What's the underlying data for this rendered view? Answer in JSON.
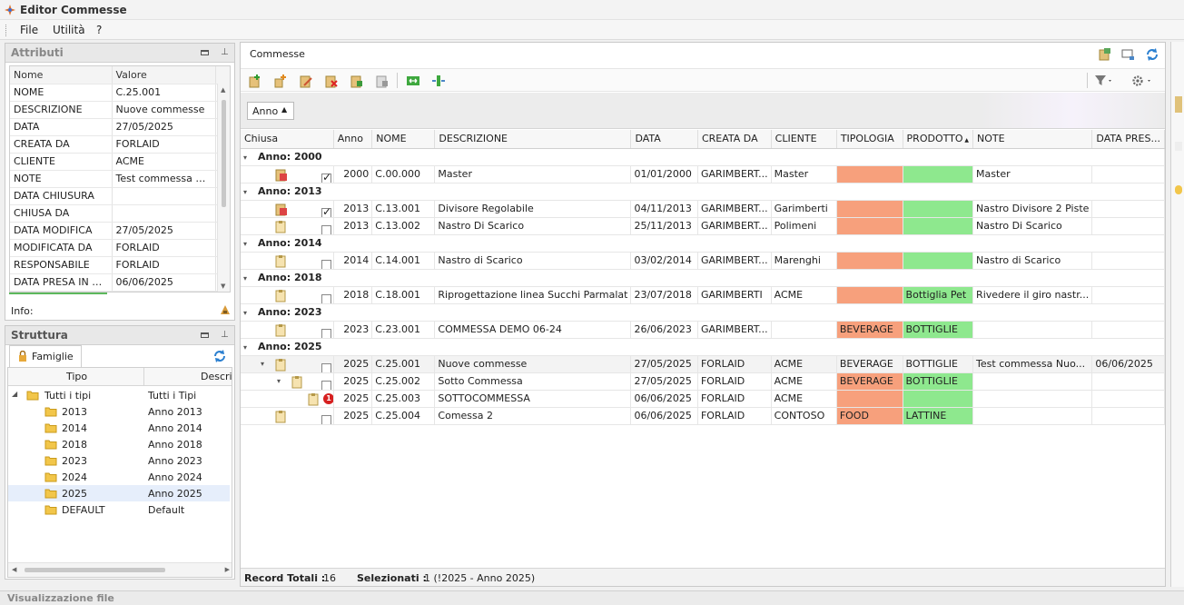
{
  "window": {
    "title": "Editor Commesse"
  },
  "menu": [
    "File",
    "Utilità",
    "?"
  ],
  "attributi": {
    "title": "Attributi",
    "headers": [
      "Nome",
      "Valore"
    ],
    "rows": [
      {
        "name": "NOME",
        "value": "C.25.001"
      },
      {
        "name": "DESCRIZIONE",
        "value": "Nuove commesse"
      },
      {
        "name": "DATA",
        "value": "27/05/2025"
      },
      {
        "name": "CREATA DA",
        "value": "FORLAID"
      },
      {
        "name": "CLIENTE",
        "value": "ACME"
      },
      {
        "name": "NOTE",
        "value": "Test commessa Nuov"
      },
      {
        "name": "DATA CHIUSURA",
        "value": ""
      },
      {
        "name": "CHIUSA DA",
        "value": ""
      },
      {
        "name": "DATA MODIFICA",
        "value": "27/05/2025"
      },
      {
        "name": "MODIFICATA DA",
        "value": "FORLAID"
      },
      {
        "name": "RESPONSABILE",
        "value": "FORLAID"
      },
      {
        "name": "DATA PRESA IN CA...",
        "value": "06/06/2025"
      }
    ],
    "info_label": "Info:"
  },
  "struttura": {
    "title": "Struttura",
    "tab": "Famiglie",
    "headers": [
      "Tipo",
      "Descriz"
    ],
    "items": [
      {
        "tipo": "Tutti i tipi",
        "descr": "Tutti i Tipi",
        "root": true
      },
      {
        "tipo": "2013",
        "descr": "Anno 2013"
      },
      {
        "tipo": "2014",
        "descr": "Anno 2014"
      },
      {
        "tipo": "2018",
        "descr": "Anno 2018"
      },
      {
        "tipo": "2023",
        "descr": "Anno 2023"
      },
      {
        "tipo": "2024",
        "descr": "Anno 2024"
      },
      {
        "tipo": "2025",
        "descr": "Anno 2025",
        "selected": true
      },
      {
        "tipo": "DEFAULT",
        "descr": "Default"
      }
    ]
  },
  "commesse": {
    "title": "Commesse",
    "group_chip": "Anno",
    "columns": [
      "Chiusa",
      "Anno",
      "NOME",
      "DESCRIZIONE",
      "DATA",
      "CREATA DA",
      "CLIENTE",
      "TIPOLOGIA",
      "PRODOTTO",
      "NOTE",
      "DATA PRES..."
    ],
    "groups": [
      {
        "label": "Anno: 2000",
        "rows": [
          {
            "level": 0,
            "expand": false,
            "red": true,
            "checked": true,
            "badge": "",
            "anno": "2000",
            "nome": "C.00.000",
            "descr": "Master",
            "data": "01/01/2000",
            "creata": "GARIMBERT...",
            "cliente": "Master",
            "tipologia": "",
            "tip_color": "#f7a07c",
            "prodotto": "",
            "prod_color": "#8ee88e",
            "note": "Master",
            "dpres": ""
          }
        ]
      },
      {
        "label": "Anno: 2013",
        "rows": [
          {
            "level": 0,
            "expand": false,
            "red": true,
            "checked": true,
            "badge": "",
            "anno": "2013",
            "nome": "C.13.001",
            "descr": "Divisore Regolabile",
            "data": "04/11/2013",
            "creata": "GARIMBERT...",
            "cliente": "Garimberti",
            "tipologia": "",
            "tip_color": "#f7a07c",
            "prodotto": "",
            "prod_color": "#8ee88e",
            "note": "Nastro Divisore 2 Piste",
            "dpres": ""
          },
          {
            "level": 0,
            "expand": false,
            "red": false,
            "checked": false,
            "badge": "",
            "anno": "2013",
            "nome": "C.13.002",
            "descr": "Nastro Di Scarico",
            "data": "25/11/2013",
            "creata": "GARIMBERT...",
            "cliente": "Polimeni",
            "tipologia": "",
            "tip_color": "#f7a07c",
            "prodotto": "",
            "prod_color": "#8ee88e",
            "note": "Nastro Di Scarico",
            "dpres": ""
          }
        ]
      },
      {
        "label": "Anno: 2014",
        "rows": [
          {
            "level": 0,
            "expand": false,
            "red": false,
            "checked": false,
            "badge": "",
            "anno": "2014",
            "nome": "C.14.001",
            "descr": "Nastro di Scarico",
            "data": "03/02/2014",
            "creata": "GARIMBERT...",
            "cliente": "Marenghi",
            "tipologia": "",
            "tip_color": "#f7a07c",
            "prodotto": "",
            "prod_color": "#8ee88e",
            "note": "Nastro di Scarico",
            "dpres": ""
          }
        ]
      },
      {
        "label": "Anno: 2018",
        "rows": [
          {
            "level": 0,
            "expand": false,
            "red": false,
            "checked": false,
            "badge": "",
            "anno": "2018",
            "nome": "C.18.001",
            "descr": "Riprogettazione linea Succhi Parmalat",
            "data": "23/07/2018",
            "creata": "GARIMBERTI",
            "cliente": "ACME",
            "tipologia": "",
            "tip_color": "#f7a07c",
            "prodotto": "Bottiglia Pet",
            "prod_color": "#8ee88e",
            "note": "Rivedere il giro nastr...",
            "dpres": ""
          }
        ]
      },
      {
        "label": "Anno: 2023",
        "rows": [
          {
            "level": 0,
            "expand": false,
            "red": false,
            "checked": false,
            "badge": "",
            "anno": "2023",
            "nome": "C.23.001",
            "descr": "COMMESSA DEMO 06-24",
            "data": "26/06/2023",
            "creata": "GARIMBERT...",
            "cliente": "",
            "tipologia": "BEVERAGE",
            "tip_color": "#f7a07c",
            "prodotto": "BOTTIGLIE",
            "prod_color": "#8ee88e",
            "note": "",
            "dpres": ""
          }
        ]
      },
      {
        "label": "Anno: 2025",
        "rows": [
          {
            "level": 0,
            "expand": true,
            "red": false,
            "checked": false,
            "badge": "",
            "anno": "2025",
            "nome": "C.25.001",
            "descr": "Nuove commesse",
            "data": "27/05/2025",
            "creata": "FORLAID",
            "cliente": "ACME",
            "tipologia": "BEVERAGE",
            "tip_color": "",
            "prodotto": "BOTTIGLIE",
            "prod_color": "",
            "note": "Test commessa Nuo...",
            "dpres": "06/06/2025",
            "selected": true
          },
          {
            "level": 1,
            "expand": true,
            "red": false,
            "checked": false,
            "badge": "",
            "anno": "2025",
            "nome": "C.25.002",
            "descr": "Sotto Commessa",
            "data": "27/05/2025",
            "creata": "FORLAID",
            "cliente": "ACME",
            "tipologia": "BEVERAGE",
            "tip_color": "#f7a07c",
            "prodotto": "BOTTIGLIE",
            "prod_color": "#8ee88e",
            "note": "",
            "dpres": ""
          },
          {
            "level": 2,
            "expand": false,
            "red": false,
            "checked": false,
            "badge": "1",
            "anno": "2025",
            "nome": "C.25.003",
            "descr": "SOTTOCOMMESSA",
            "data": "06/06/2025",
            "creata": "FORLAID",
            "cliente": "ACME",
            "tipologia": "",
            "tip_color": "#f7a07c",
            "prodotto": "",
            "prod_color": "#8ee88e",
            "note": "",
            "dpres": ""
          },
          {
            "level": 0,
            "expand": false,
            "red": false,
            "checked": false,
            "badge": "",
            "anno": "2025",
            "nome": "C.25.004",
            "descr": "Comessa 2",
            "data": "06/06/2025",
            "creata": "FORLAID",
            "cliente": "CONTOSO",
            "tipologia": "FOOD",
            "tip_color": "#f7a07c",
            "prodotto": "LATTINE",
            "prod_color": "#8ee88e",
            "note": "",
            "dpres": ""
          }
        ]
      }
    ],
    "footer": {
      "totali_label": "Record Totali :",
      "totali_value": "16",
      "selezionati_label": "Selezionati :",
      "selezionati_value": "1 (!2025 - Anno 2025)"
    }
  },
  "bottom_panel": {
    "title": "Visualizzazione file"
  }
}
